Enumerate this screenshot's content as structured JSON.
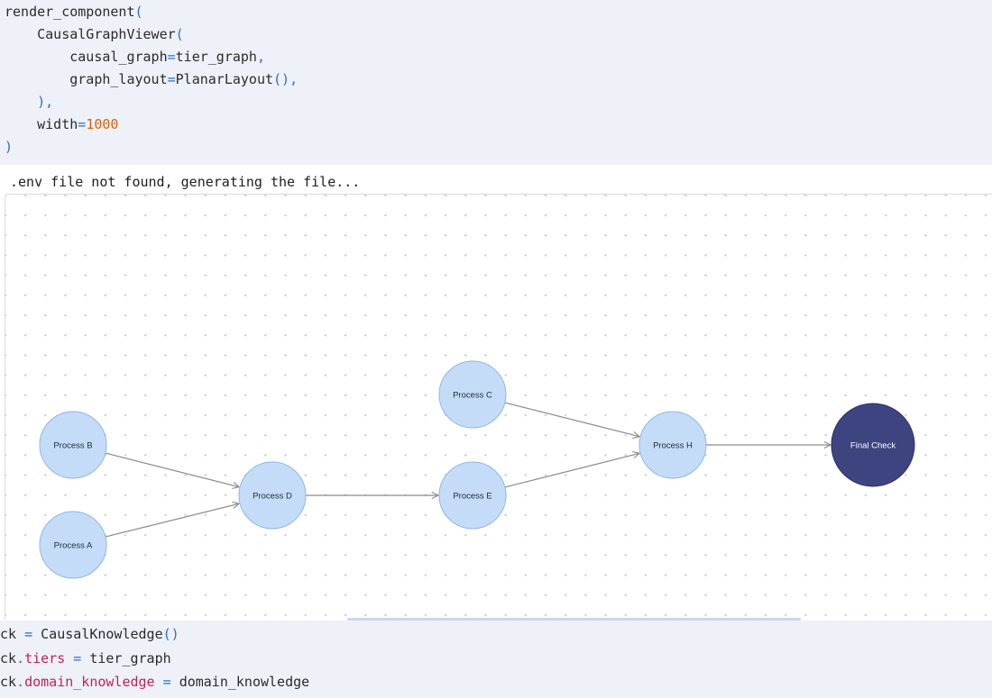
{
  "code_top": {
    "line1_fn": "render_component",
    "line1_paren": "(",
    "line2_indent": "    ",
    "line2_fn": "CausalGraphViewer",
    "line2_paren": "(",
    "line3_indent": "        ",
    "line3_kw": "causal_graph",
    "line3_eq": "=",
    "line3_val": "tier_graph",
    "line3_comma": ",",
    "line4_indent": "        ",
    "line4_kw": "graph_layout",
    "line4_eq": "=",
    "line4_val": "PlanarLayout",
    "line4_parens": "()",
    "line4_comma": ",",
    "line5_indent": "    ",
    "line5_paren": ")",
    "line5_comma": ",",
    "line6_indent": "    ",
    "line6_kw": "width",
    "line6_eq": "=",
    "line6_num": "1000",
    "line7_paren": ")"
  },
  "output": {
    "message": ".env file not found, generating the file..."
  },
  "graph": {
    "nodes": [
      {
        "id": "process-b",
        "label": "Process B"
      },
      {
        "id": "process-a",
        "label": "Process A"
      },
      {
        "id": "process-d",
        "label": "Process D"
      },
      {
        "id": "process-c",
        "label": "Process C"
      },
      {
        "id": "process-e",
        "label": "Process E"
      },
      {
        "id": "process-h",
        "label": "Process H"
      },
      {
        "id": "final-check",
        "label": "Final Check"
      }
    ],
    "edges": [
      {
        "from": "process-b",
        "to": "process-d"
      },
      {
        "from": "process-a",
        "to": "process-d"
      },
      {
        "from": "process-d",
        "to": "process-e"
      },
      {
        "from": "process-c",
        "to": "process-h"
      },
      {
        "from": "process-e",
        "to": "process-h"
      },
      {
        "from": "process-h",
        "to": "final-check"
      }
    ],
    "colors": {
      "node_fill": "#c5dcf8",
      "node_stroke": "#8fb6e8",
      "final_fill": "#3d4480",
      "final_stroke": "#2b3170",
      "edge": "#8a8a8a",
      "label": "#1e2a3a",
      "final_label": "#ffffff"
    }
  },
  "code_bottom": {
    "l1_obj": "ck",
    "l1_eq": " = ",
    "l1_fn": "CausalKnowledge",
    "l1_parens": "()",
    "l2_obj": "ck",
    "l2_dot": ".",
    "l2_attr": "tiers",
    "l2_eq": " = ",
    "l2_val": "tier_graph",
    "l3_obj": "ck",
    "l3_dot": ".",
    "l3_attr": "domain_knowledge",
    "l3_eq": " = ",
    "l3_val": "domain_knowledge"
  }
}
